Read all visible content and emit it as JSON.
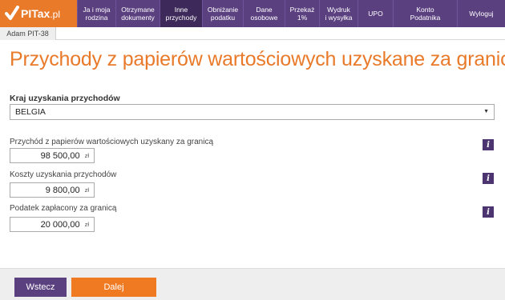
{
  "app": {
    "logo_text": "PITax",
    "logo_suffix": ".pl"
  },
  "nav": {
    "items": [
      {
        "label": "Ja i moja\nrodzina"
      },
      {
        "label": "Otrzymane\ndokumenty"
      },
      {
        "label": "Inne\nprzychody"
      },
      {
        "label": "Obniżanie\npodatku"
      },
      {
        "label": "Dane\nosobowe"
      },
      {
        "label": "Przekaż\n1%"
      },
      {
        "label": "Wydruk\ni wysyłka"
      },
      {
        "label": "UPO"
      },
      {
        "label": "Konto\nPodatnika"
      },
      {
        "label": "Wyloguj"
      }
    ],
    "active_index": 2
  },
  "subtab": {
    "label": "Adam PIT-38"
  },
  "page": {
    "title": "Przychody z papierów wartościowych uzyskane za granicą"
  },
  "country": {
    "label": "Kraj uzyskania przychodów",
    "selected": "BELGIA"
  },
  "fields": [
    {
      "label": "Przychód z papierów wartościowych uzyskany za granicą",
      "value": "98 500,00",
      "unit": "zł"
    },
    {
      "label": "Koszty uzyskania przychodów",
      "value": "9 800,00",
      "unit": "zł"
    },
    {
      "label": "Podatek zapłacony za granicą",
      "value": "20 000,00",
      "unit": "zł"
    }
  ],
  "info_icon_glyph": "i",
  "buttons": {
    "back": "Wstecz",
    "next": "Dalej"
  },
  "colors": {
    "nav_bg": "#5b4080",
    "nav_active": "#3d2a5a",
    "accent_orange": "#e87a2a",
    "next_button": "#f07a22"
  }
}
